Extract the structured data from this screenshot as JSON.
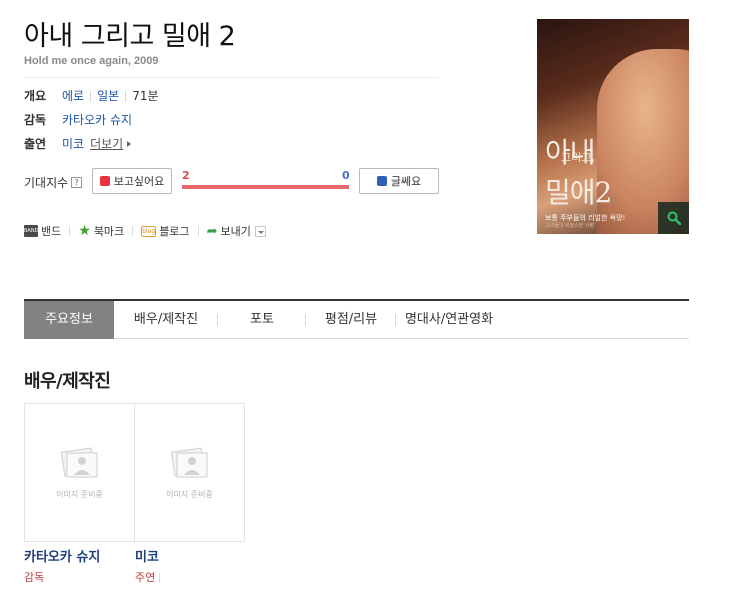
{
  "movie": {
    "title": "아내 그리고 밀애 2",
    "subtitle": "Hold me once again, 2009"
  },
  "info": {
    "overview_label": "개요",
    "genre": "에로",
    "country": "일본",
    "runtime": "71분",
    "director_label": "감독",
    "director": "카타오카 슈지",
    "cast_label": "출연",
    "cast": "미코",
    "more_label": "더보기"
  },
  "expectation": {
    "label": "기대지수",
    "help": "?",
    "want_label": "보고싶어요",
    "nah_label": "글쎄요",
    "want_count": "2",
    "nah_count": "0",
    "want_ratio": 1.0
  },
  "share": {
    "band_label": "밴드",
    "band_icon_text": "BAND",
    "bookmark_label": "북마크",
    "blog_label": "블로그",
    "blog_icon_text": "blog",
    "send_label": "보내기"
  },
  "poster": {
    "line1": "아내",
    "line2": "그리고,",
    "line3": "밀애2",
    "tagline": "보통 주부들의 리얼한 욕망!",
    "fine_print": "그녀들의 비밀스런 사랑"
  },
  "tabs": [
    {
      "label": "주요정보"
    },
    {
      "label": "배우/제작진"
    },
    {
      "label": "포토"
    },
    {
      "label": "평점/리뷰"
    },
    {
      "label": "명대사/연관영화"
    }
  ],
  "section": {
    "title": "배우/제작진"
  },
  "people": [
    {
      "name": "카타오카 슈지",
      "role": "감독",
      "placeholder": "이미지 준비중"
    },
    {
      "name": "미코",
      "role": "주연",
      "placeholder": "이미지 준비중"
    }
  ],
  "colors": {
    "link": "#1b55a8",
    "want": "#e8333f",
    "nah": "#2e62b7",
    "active_tab": "#828282",
    "role": "#c43b3b"
  }
}
